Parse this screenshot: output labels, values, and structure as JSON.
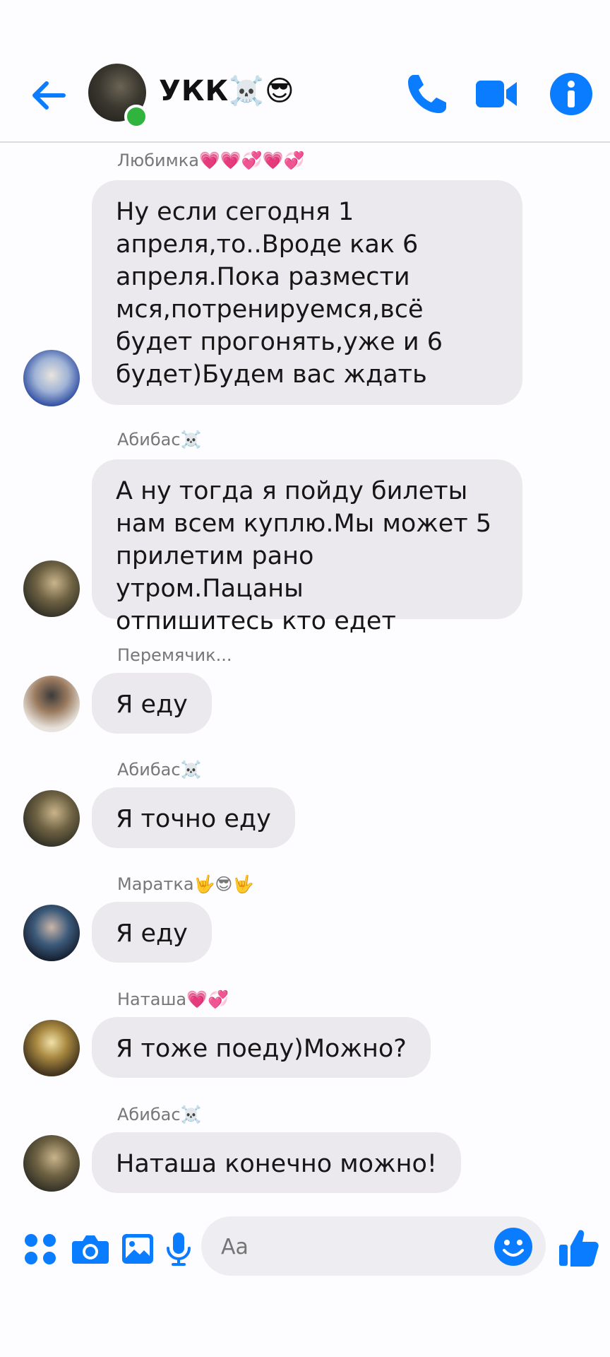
{
  "header": {
    "title": "УКК☠️😎",
    "back_icon": "back-arrow-icon",
    "actions": [
      "phone-icon",
      "video-camera-icon",
      "info-icon"
    ],
    "accent": "#0a7cff",
    "online_color": "#31b43e"
  },
  "messages": [
    {
      "sender": "Любимка💗💗💞💗💞",
      "text": "Ну если сегодня 1 апреля,то..Вроде как 6 апреля.Пока размести мся,потренируемся,всё будет прогонять,уже и 6 будет)Будем вас ждать",
      "lines": [
        "Ну если сегодня 1",
        "апреля,то..Вроде как 6",
        "апреля.Пока размести",
        "мся,потренируемся,всё",
        "будет прогонять,уже и 6",
        "будет)Будем вас ждать"
      ]
    },
    {
      "sender": "Абибас☠️",
      "text": "А ну тогда я пойду билеты нам всем куплю.Мы может 5 прилетим рано утром.Пацаны отпишитесь кто едет",
      "lines": [
        "А ну тогда я пойду билеты",
        "нам всем куплю.Мы может 5",
        "прилетим рано утром.Пацаны",
        "отпишитесь кто едет"
      ]
    },
    {
      "sender": "Перемячик...",
      "text": "Я еду"
    },
    {
      "sender": "Абибас☠️",
      "text": "Я точно еду"
    },
    {
      "sender": "Маратка🤟😎🤟",
      "text": "Я еду"
    },
    {
      "sender": "Наташа💗💞",
      "text": "Я тоже поеду)Можно?"
    },
    {
      "sender": "Абибас☠️",
      "text": "Наташа конечно можно!"
    }
  ],
  "composer": {
    "placeholder": "Aa",
    "icons": [
      "apps-icon",
      "camera-icon",
      "gallery-icon",
      "microphone-icon",
      "emoji-icon",
      "thumbs-up-icon"
    ],
    "bubble_color": "#ebe9ee"
  }
}
